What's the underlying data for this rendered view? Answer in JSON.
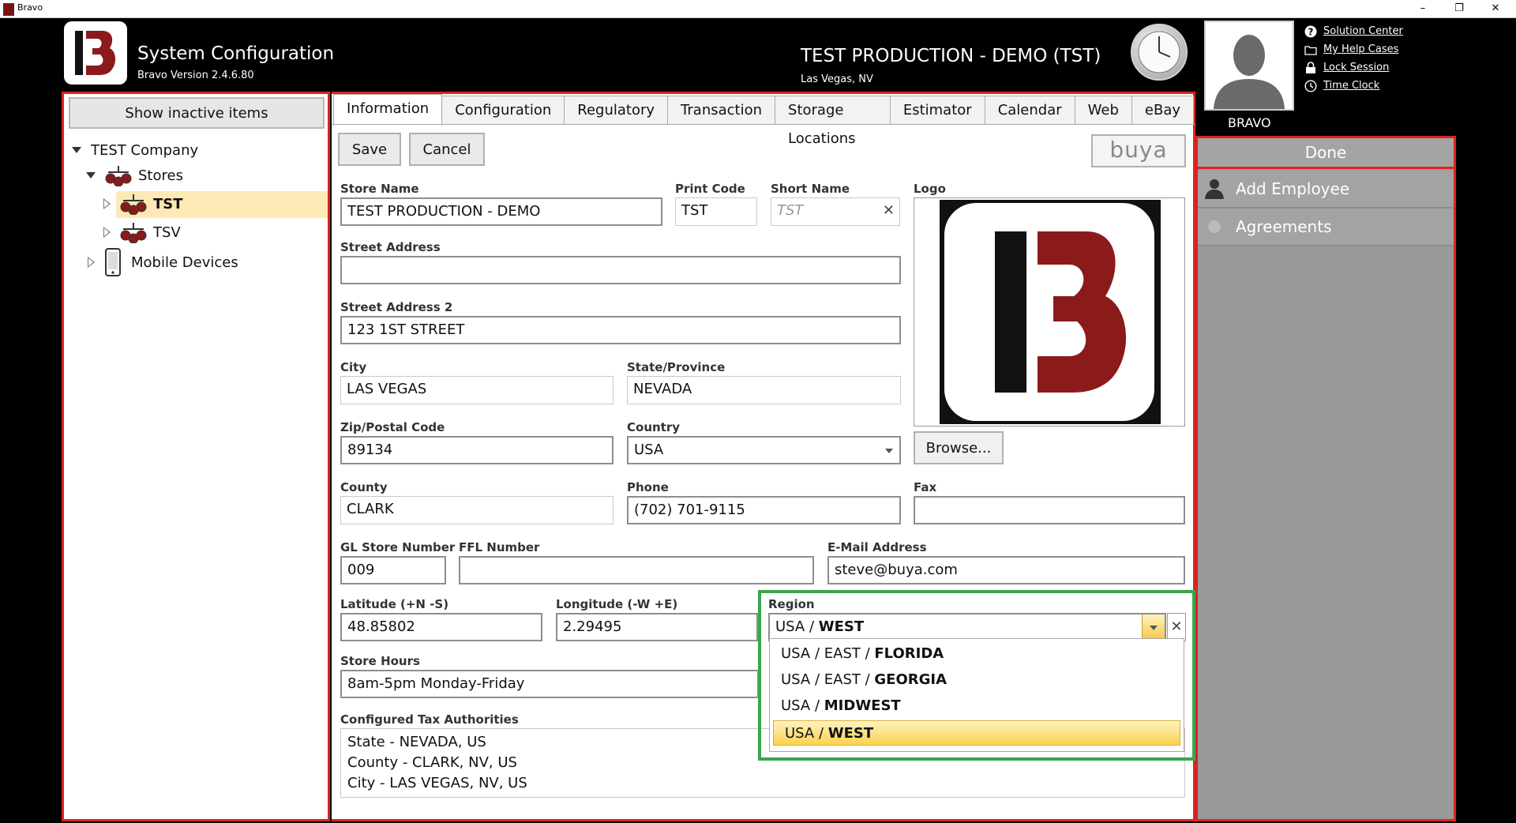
{
  "window": {
    "title": "Bravo",
    "minimize": "–",
    "restore": "❐",
    "close": "✕"
  },
  "header": {
    "app_title": "System Configuration",
    "version": "Bravo Version 2.4.6.80",
    "store_title": "TEST PRODUCTION - DEMO (TST)",
    "store_location": "Las Vegas, NV",
    "user_name": "BRAVO",
    "links": [
      "Solution Center",
      "My Help Cases",
      "Lock Session",
      "Time Clock"
    ]
  },
  "left_panel": {
    "show_inactive_label": "Show inactive items",
    "tree": {
      "company": "TEST Company",
      "stores": "Stores",
      "store_tst": "TST",
      "store_tsv": "TSV",
      "mobile": "Mobile Devices"
    }
  },
  "tabs": [
    "Information",
    "Configuration",
    "Regulatory",
    "Transaction",
    "Storage Locations",
    "Estimator",
    "Calendar",
    "Web",
    "eBay"
  ],
  "toolbar": {
    "save": "Save",
    "cancel": "Cancel",
    "buya_logo": "buya"
  },
  "form": {
    "store_name": {
      "label": "Store Name",
      "value": "TEST PRODUCTION - DEMO"
    },
    "print_code": {
      "label": "Print Code",
      "value": "TST"
    },
    "short_name": {
      "label": "Short Name",
      "placeholder": "TST"
    },
    "logo_label": "Logo",
    "browse": "Browse...",
    "street": {
      "label": "Street Address",
      "value": ""
    },
    "street2": {
      "label": "Street Address 2",
      "value": "123 1ST STREET"
    },
    "city": {
      "label": "City",
      "value": "LAS VEGAS"
    },
    "state": {
      "label": "State/Province",
      "value": "NEVADA"
    },
    "zip": {
      "label": "Zip/Postal Code",
      "value": "89134"
    },
    "country": {
      "label": "Country",
      "value": "USA"
    },
    "county": {
      "label": "County",
      "value": "CLARK"
    },
    "phone": {
      "label": "Phone",
      "value": "(702) 701-9115"
    },
    "fax": {
      "label": "Fax",
      "value": ""
    },
    "gl": {
      "label": "GL Store Number",
      "value": "009"
    },
    "ffl": {
      "label": "FFL Number",
      "value": ""
    },
    "email": {
      "label": "E-Mail Address",
      "value": "steve@buya.com"
    },
    "lat": {
      "label": "Latitude (+N -S)",
      "value": "48.85802"
    },
    "lon": {
      "label": "Longitude (-W +E)",
      "value": "2.29495"
    },
    "region": {
      "label": "Region",
      "selected_prefix": "USA / ",
      "selected_bold": "WEST",
      "options": [
        {
          "prefix": "USA / EAST / ",
          "bold": "FLORIDA"
        },
        {
          "prefix": "USA / EAST / ",
          "bold": "GEORGIA"
        },
        {
          "prefix": "USA / ",
          "bold": "MIDWEST"
        },
        {
          "prefix": "USA / ",
          "bold": "WEST"
        }
      ]
    },
    "hours": {
      "label": "Store Hours",
      "value": "8am-5pm Monday-Friday"
    },
    "tax": {
      "label": "Configured Tax Authorities",
      "lines": [
        "State - NEVADA, US",
        "County - CLARK, NV, US",
        "City - LAS VEGAS, NV, US"
      ]
    }
  },
  "right_panel": {
    "done": "Done",
    "add_employee": "Add Employee",
    "agreements": "Agreements"
  },
  "colors": {
    "highlight_red": "#dd2222",
    "annotation_green": "#3aa64c",
    "brand_red": "#8b1a1a"
  }
}
